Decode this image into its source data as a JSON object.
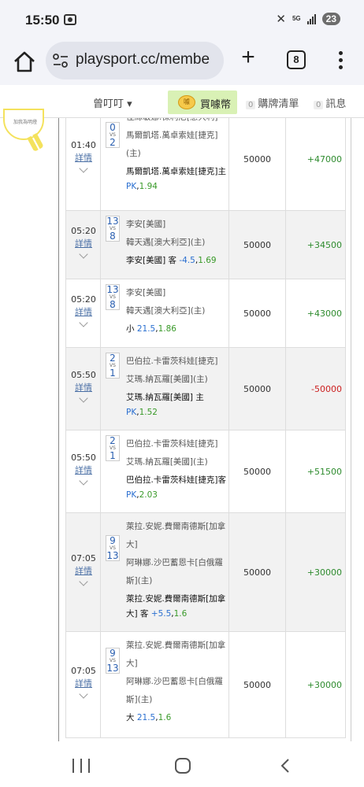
{
  "status_bar": {
    "time": "15:50",
    "network": "5G",
    "battery": "23"
  },
  "browser": {
    "url": "playsport.cc/membe",
    "tab_count": "8"
  },
  "site_nav": {
    "user_name": "曾叮叮",
    "buy_label": "買噱幣",
    "coin_label": "噱",
    "cart_count": "0",
    "cart_label": "購牌清單",
    "msg_count": "0",
    "msg_label": "訊息"
  },
  "bulb_text": "加我為明燈",
  "detail_label": "詳情",
  "vs_label": "VS",
  "rows": [
    {
      "time": "01:40",
      "score_a": "0",
      "score_b": "2",
      "team_lines": [
        "佳絲敏娜.保利尼[意大利]",
        "馬爾凱塔.萬卓索娃[捷克]",
        "(主)"
      ],
      "pick_text": "馬爾凱塔.萬卓索娃[捷克]主",
      "pick_odds": "PK",
      "pick_price": "1.94",
      "amount": "50000",
      "result": "+47000",
      "result_sign": "pos"
    },
    {
      "time": "05:20",
      "score_a": "13",
      "score_b": "8",
      "team_lines": [
        "李安[美國]",
        "韓天遇[澳大利亞](主)"
      ],
      "pick_text": "李安[美國] 客",
      "pick_odds": "-4.5",
      "pick_price": "1.69",
      "amount": "50000",
      "result": "+34500",
      "result_sign": "pos"
    },
    {
      "time": "05:20",
      "score_a": "13",
      "score_b": "8",
      "team_lines": [
        "李安[美國]",
        "韓天遇[澳大利亞](主)"
      ],
      "pick_text": "小",
      "pick_odds": "21.5",
      "pick_price": "1.86",
      "amount": "50000",
      "result": "+43000",
      "result_sign": "pos"
    },
    {
      "time": "05:50",
      "score_a": "2",
      "score_b": "1",
      "team_lines": [
        "巴伯拉.卡雷茨科娃[捷克]",
        "艾瑪.納瓦羅[美國](主)"
      ],
      "pick_text": "艾瑪.納瓦羅[美國] 主",
      "pick_odds": "PK",
      "pick_price": "1.52",
      "amount": "50000",
      "result": "-50000",
      "result_sign": "neg"
    },
    {
      "time": "05:50",
      "score_a": "2",
      "score_b": "1",
      "team_lines": [
        "巴伯拉.卡雷茨科娃[捷克]",
        "艾瑪.納瓦羅[美國](主)"
      ],
      "pick_text": "巴伯拉.卡雷茨科娃[捷克]客",
      "pick_odds": "PK",
      "pick_price": "2.03",
      "amount": "50000",
      "result": "+51500",
      "result_sign": "pos"
    },
    {
      "time": "07:05",
      "score_a": "9",
      "score_b": "13",
      "team_lines": [
        "萊拉.安妮.費爾南德斯[加拿",
        "大]",
        "阿琳娜.沙巴蓄恩卡[白俄羅",
        "斯](主)"
      ],
      "pick_text": "萊拉.安妮.費爾南德斯[加拿大] 客",
      "pick_odds": "+5.5",
      "pick_price": "1.6",
      "amount": "50000",
      "result": "+30000",
      "result_sign": "pos"
    },
    {
      "time": "07:05",
      "score_a": "9",
      "score_b": "13",
      "team_lines": [
        "萊拉.安妮.費爾南德斯[加拿",
        "大]",
        "阿琳娜.沙巴蓄恩卡[白俄羅",
        "斯](主)"
      ],
      "pick_text": "大",
      "pick_odds": "21.5",
      "pick_price": "1.6",
      "amount": "50000",
      "result": "+30000",
      "result_sign": "pos"
    }
  ]
}
